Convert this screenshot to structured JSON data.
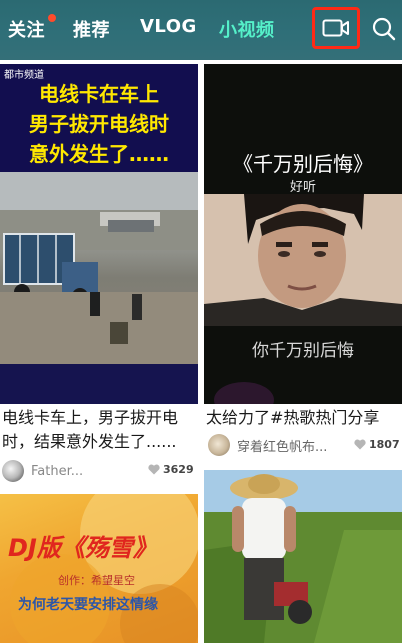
{
  "header": {
    "tabs": [
      {
        "label": "关注",
        "has_dot": true
      },
      {
        "label": "推荐"
      },
      {
        "label": "VLOG"
      },
      {
        "label": "小视频",
        "active": true
      }
    ],
    "camera_icon": "video-camera-icon",
    "search_icon": "search-icon",
    "accent_color": "#55f0c9",
    "highlight_color": "#ff2a16"
  },
  "feed": [
    {
      "thumb": {
        "logo": "都市频道",
        "lines": [
          "电线卡在车上",
          "男子拔开电线时",
          "意外发生了……"
        ]
      },
      "title": "电线卡车上，男子拔开电时，结果意外发生了......",
      "author": "Father...",
      "likes": "3629"
    },
    {
      "thumb": {
        "title": "《千万别后悔》",
        "subtitle": "好听",
        "caption": "你千万别后悔"
      },
      "title": "太给力了#热歌热门分享",
      "author": "穿着红色帆布...",
      "likes": "1807"
    },
    {
      "thumb": {
        "main": "DJ版《殇雪》",
        "sub": "创作：希望星空",
        "line": "为何老天要安排这情缘"
      }
    },
    {
      "thumb": {}
    }
  ]
}
